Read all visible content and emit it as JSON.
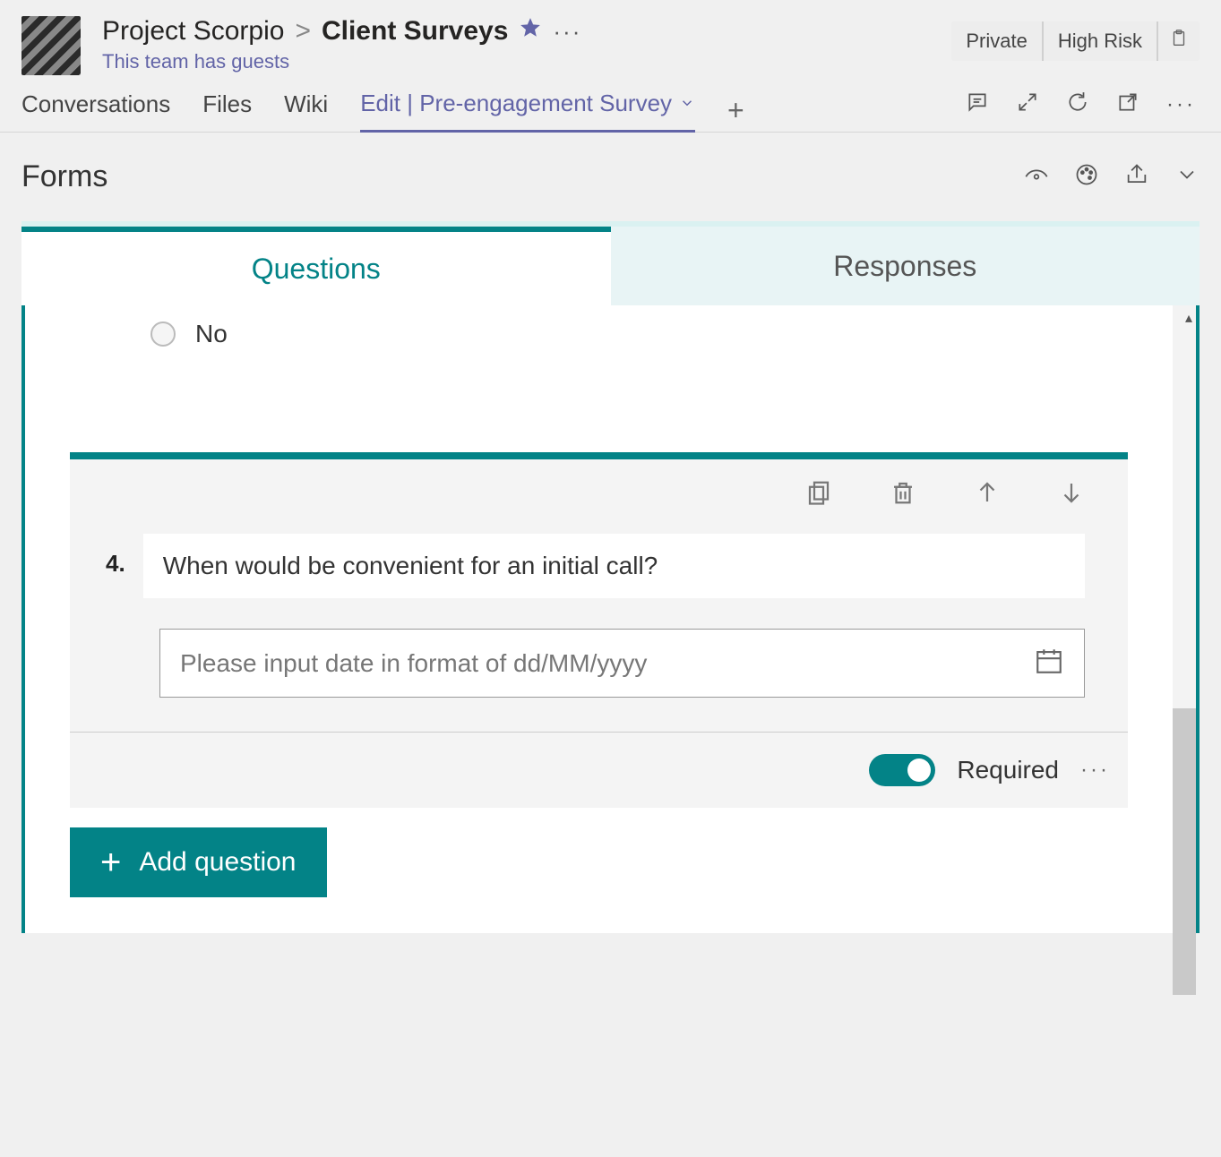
{
  "header": {
    "team_name": "Project Scorpio",
    "breadcrumb_sep": ">",
    "channel_name": "Client Surveys",
    "subtitle": "This team has guests",
    "badges": {
      "privacy": "Private",
      "risk": "High Risk"
    }
  },
  "channel_tabs": {
    "items": [
      "Conversations",
      "Files",
      "Wiki"
    ],
    "active": "Edit | Pre-engagement Survey"
  },
  "forms_header": {
    "title": "Forms"
  },
  "form_tabs": {
    "questions": "Questions",
    "responses": "Responses"
  },
  "visible_option": {
    "label": "No"
  },
  "question": {
    "number": "4.",
    "text": "When would be convenient for an initial call?",
    "date_placeholder": "Please input date in format of dd/MM/yyyy",
    "required_label": "Required",
    "required_on": true
  },
  "add_button": {
    "label": "Add question"
  }
}
